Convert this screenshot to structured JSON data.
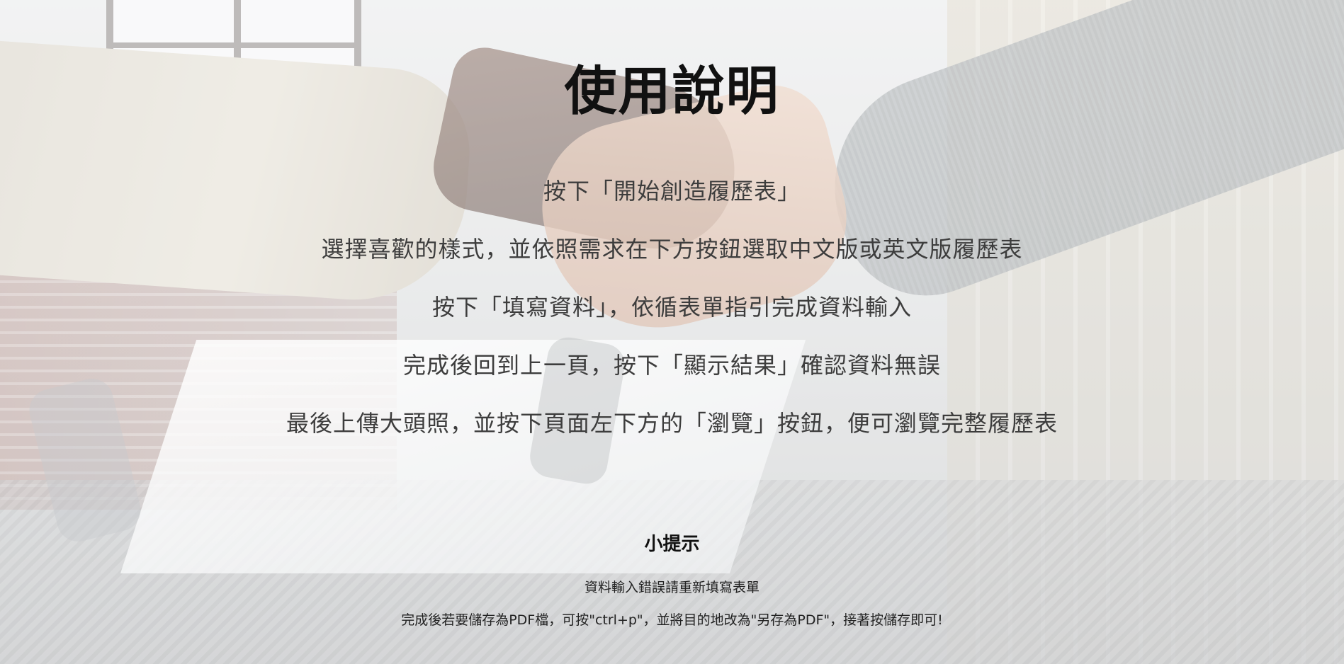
{
  "page": {
    "title": "使用說明",
    "steps": [
      "按下「開始創造履歷表」",
      "選擇喜歡的樣式，並依照需求在下方按鈕選取中文版或英文版履歷表",
      "按下「填寫資料」，依循表單指引完成資料輸入",
      "完成後回到上一頁，按下「顯示結果」確認資料無誤",
      "最後上傳大頭照，並按下頁面左下方的「瀏覽」按鈕，便可瀏覽完整履歷表"
    ],
    "tips": {
      "title": "小提示",
      "items": [
        "資料輸入錯誤請重新填寫表單",
        "完成後若要儲存為PDF檔，可按\"ctrl+p\"，並將目的地改為\"另存為PDF\"，接著按儲存即可!"
      ]
    }
  },
  "background": {
    "image": "handshake-office-photo",
    "overlay_color": "#ffffff"
  }
}
